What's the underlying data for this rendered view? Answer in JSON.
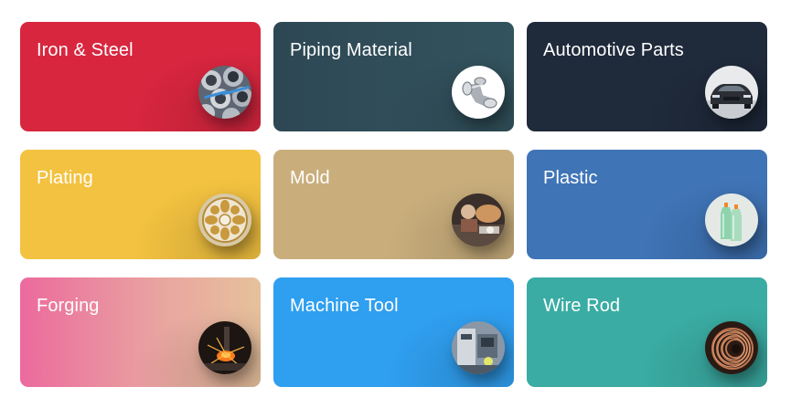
{
  "categories": [
    {
      "label": "Iron & Steel",
      "icon": "steel-pipes-icon",
      "color": "#d8263f"
    },
    {
      "label": "Piping Material",
      "icon": "pipe-elbow-icon",
      "color": "#2f4c57"
    },
    {
      "label": "Automotive Parts",
      "icon": "car-icon",
      "color": "#1f2a3b"
    },
    {
      "label": "Plating",
      "icon": "plated-ornament-icon",
      "color": "#f3c240"
    },
    {
      "label": "Mold",
      "icon": "mold-work-icon",
      "color": "#c9ae7c"
    },
    {
      "label": "Plastic",
      "icon": "plastic-bottles-icon",
      "color": "#3f74b7"
    },
    {
      "label": "Forging",
      "icon": "forging-sparks-icon",
      "color": "#ec6a9e"
    },
    {
      "label": "Machine Tool",
      "icon": "machine-tool-icon",
      "color": "#2f9ff0"
    },
    {
      "label": "Wire Rod",
      "icon": "wire-coil-icon",
      "color": "#3aaca3"
    }
  ]
}
